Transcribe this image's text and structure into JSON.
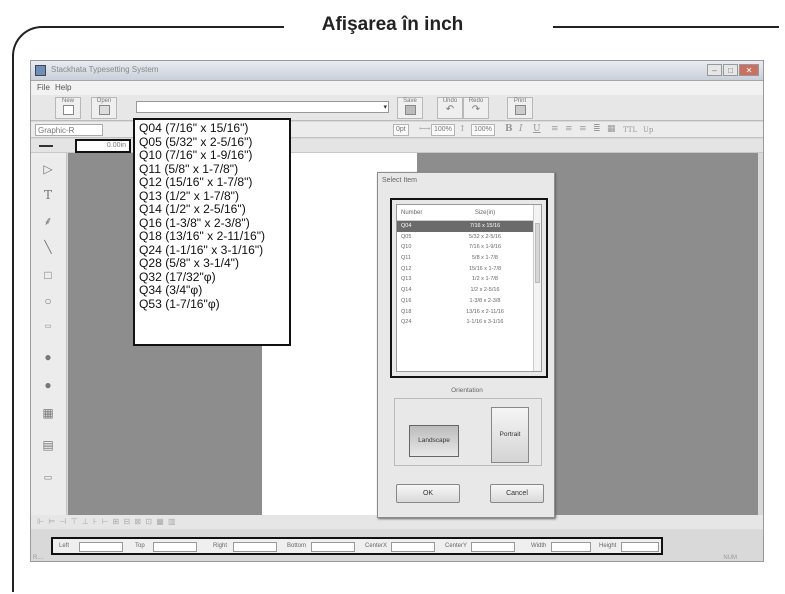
{
  "figure_title": "Afişarea în inch",
  "window": {
    "title": "Stackhata Typesetting System",
    "controls": [
      "min",
      "max",
      "close"
    ]
  },
  "menu": [
    "File",
    "Help"
  ],
  "toolbar": {
    "new": "New",
    "open": "Open",
    "save": "Save",
    "undo": "Undo",
    "redo": "Redo",
    "print": "Print"
  },
  "format_bar": {
    "font": "Graphic-R",
    "size": "0pt",
    "width_pct": "100%",
    "height_pct": "100%",
    "bold": "B",
    "italic": "I",
    "underline": "U",
    "ttl": "TTL",
    "up": "Up"
  },
  "line_width_value": "0.00in",
  "tape_list": [
    "Q04 (7/16\" x 15/16\")",
    "Q05 (5/32\" x 2-5/16\")",
    "Q10 (7/16\" x 1-9/16\")",
    "Q11 (5/8\" x 1-7/8\")",
    "Q12 (15/16\" x 1-7/8\")",
    "Q13 (1/2\" x 1-7/8\")",
    "Q14 (1/2\" x 2-5/16\")",
    "Q16 (1-3/8\" x 2-3/8\")",
    "Q18 (13/16\" x 2-11/16\")",
    "Q24 (1-1/16\" x 3-1/16\")",
    "Q28 (5/8\" x 3-1/4\")",
    "Q32 (17/32\"φ)",
    "Q34 (3/4\"φ)",
    "Q53 (1-7/16\"φ)"
  ],
  "dialog": {
    "title": "Select Item",
    "col_number": "Number",
    "col_size": "Size(in)",
    "rows": [
      {
        "n": "Q04",
        "s": "7/16 x 15/16",
        "selected": true
      },
      {
        "n": "Q05",
        "s": "5/32 x 2-5/16"
      },
      {
        "n": "Q10",
        "s": "7/16 x 1-9/16"
      },
      {
        "n": "Q11",
        "s": "5/8 x 1-7/8"
      },
      {
        "n": "Q12",
        "s": "15/16 x 1-7/8"
      },
      {
        "n": "Q13",
        "s": "1/2 x 1-7/8"
      },
      {
        "n": "Q14",
        "s": "1/2 x 2-5/16"
      },
      {
        "n": "Q16",
        "s": "1-3/8 x 2-3/8"
      },
      {
        "n": "Q18",
        "s": "13/16 x 2-11/16"
      },
      {
        "n": "Q24",
        "s": "1-1/16 x 3-1/16"
      }
    ],
    "orientation_label": "Orientation",
    "landscape": "Landscape",
    "portrait": "Portrait",
    "ok": "OK",
    "cancel": "Cancel"
  },
  "position_fields": [
    {
      "label": "Left"
    },
    {
      "label": "Top"
    },
    {
      "label": "Right"
    },
    {
      "label": "Bottom"
    },
    {
      "label": "CenterX"
    },
    {
      "label": "CenterY"
    },
    {
      "label": "Width"
    },
    {
      "label": "Height"
    }
  ],
  "status": {
    "left": "R....",
    "right": "NUM"
  }
}
